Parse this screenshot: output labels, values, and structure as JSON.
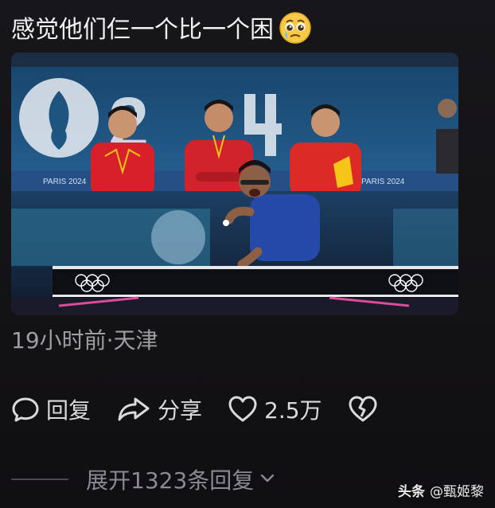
{
  "post": {
    "text": "感觉他们仨一个比一个困",
    "emoji_icon": "pleading-face-emoji"
  },
  "image": {
    "banner_logo_text": "2",
    "banner_tag_left": "PARIS 2024",
    "banner_tag_right": "PARIS 2024"
  },
  "meta": {
    "location_time": "19小时前·天津"
  },
  "actions": {
    "reply": {
      "icon": "comment-bubble-icon",
      "label": "回复"
    },
    "share": {
      "icon": "share-arrow-icon",
      "label": "分享"
    },
    "like": {
      "icon": "heart-icon",
      "label": "2.5万"
    },
    "dislike": {
      "icon": "broken-heart-icon"
    }
  },
  "comments": {
    "expand_label": "展开1323条回复"
  },
  "watermark": {
    "brand": "头条",
    "handle": "@甄姬黎"
  },
  "colors": {
    "background": "#141316",
    "text_primary": "#f1f1f3",
    "text_secondary": "#9d9da3",
    "banner_blue": "#1d4d78",
    "jersey_red": "#d8202a",
    "jersey_blue": "#2449a8"
  }
}
